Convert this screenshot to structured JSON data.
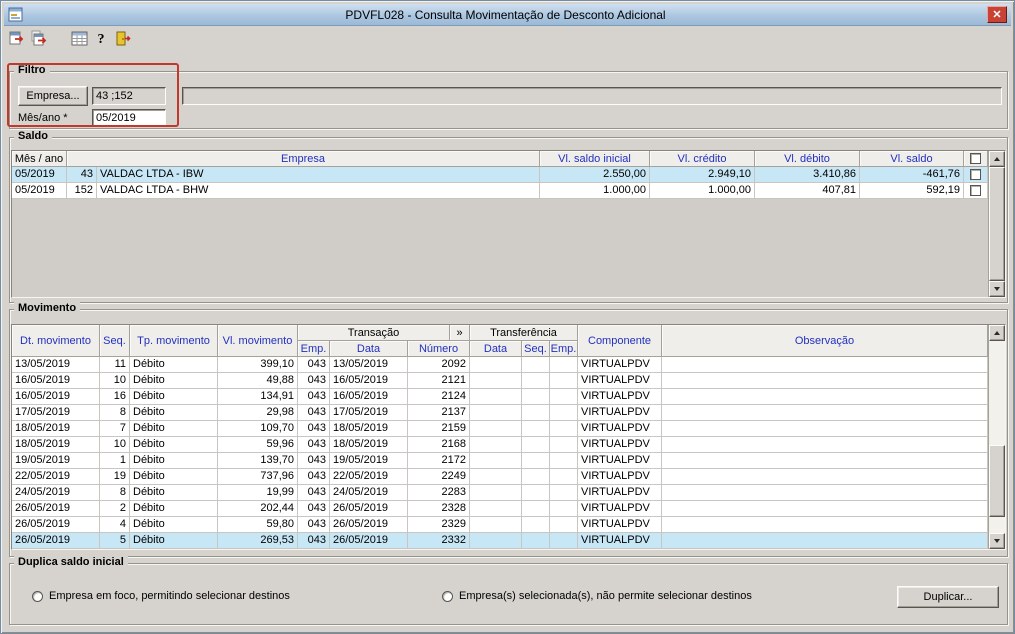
{
  "window": {
    "title": "PDVFL028 - Consulta Movimentação de Desconto Adicional",
    "close_glyph": "✕"
  },
  "toolbar": {
    "help_glyph": "?"
  },
  "filtro": {
    "legend": "Filtro",
    "empresa_button_label": "Empresa...",
    "empresa_value": "43 ;152",
    "mes_ano_label": "Mês/ano *",
    "mes_ano_value": "05/2019"
  },
  "saldo": {
    "legend": "Saldo",
    "headers": {
      "mes_ano": "Mês / ano",
      "empresa": "Empresa",
      "saldo_inicial": "Vl. saldo inicial",
      "credito": "Vl. crédito",
      "debito": "Vl. débito",
      "saldo": "Vl. saldo"
    },
    "rows": [
      {
        "mes_ano": "05/2019",
        "emp": "43",
        "empresa": "VALDAC LTDA - IBW",
        "saldo_inicial": "2.550,00",
        "credito": "2.949,10",
        "debito": "3.410,86",
        "saldo": "-461,76",
        "selected": true
      },
      {
        "mes_ano": "05/2019",
        "emp": "152",
        "empresa": "VALDAC LTDA - BHW",
        "saldo_inicial": "1.000,00",
        "credito": "1.000,00",
        "debito": "407,81",
        "saldo": "592,19",
        "selected": false
      }
    ]
  },
  "movimento": {
    "legend": "Movimento",
    "headers": {
      "dt": "Dt. movimento",
      "seq": "Seq.",
      "tp": "Tp. movimento",
      "vl": "Vl. movimento",
      "transacao": "Transação",
      "expand": "»",
      "emp": "Emp.",
      "data": "Data",
      "numero": "Número",
      "transferencia": "Transferência",
      "tr_data": "Data",
      "tr_seq": "Seq.",
      "tr_emp": "Emp.",
      "componente": "Componente",
      "observacao": "Observação"
    },
    "rows": [
      {
        "dt": "13/05/2019",
        "seq": "11",
        "tp": "Débito",
        "vl": "399,10",
        "emp": "043",
        "data": "13/05/2019",
        "numero": "2092",
        "componente": "VIRTUALPDV",
        "selected": false
      },
      {
        "dt": "16/05/2019",
        "seq": "10",
        "tp": "Débito",
        "vl": "49,88",
        "emp": "043",
        "data": "16/05/2019",
        "numero": "2121",
        "componente": "VIRTUALPDV",
        "selected": false
      },
      {
        "dt": "16/05/2019",
        "seq": "16",
        "tp": "Débito",
        "vl": "134,91",
        "emp": "043",
        "data": "16/05/2019",
        "numero": "2124",
        "componente": "VIRTUALPDV",
        "selected": false
      },
      {
        "dt": "17/05/2019",
        "seq": "8",
        "tp": "Débito",
        "vl": "29,98",
        "emp": "043",
        "data": "17/05/2019",
        "numero": "2137",
        "componente": "VIRTUALPDV",
        "selected": false
      },
      {
        "dt": "18/05/2019",
        "seq": "7",
        "tp": "Débito",
        "vl": "109,70",
        "emp": "043",
        "data": "18/05/2019",
        "numero": "2159",
        "componente": "VIRTUALPDV",
        "selected": false
      },
      {
        "dt": "18/05/2019",
        "seq": "10",
        "tp": "Débito",
        "vl": "59,96",
        "emp": "043",
        "data": "18/05/2019",
        "numero": "2168",
        "componente": "VIRTUALPDV",
        "selected": false
      },
      {
        "dt": "19/05/2019",
        "seq": "1",
        "tp": "Débito",
        "vl": "139,70",
        "emp": "043",
        "data": "19/05/2019",
        "numero": "2172",
        "componente": "VIRTUALPDV",
        "selected": false
      },
      {
        "dt": "22/05/2019",
        "seq": "19",
        "tp": "Débito",
        "vl": "737,96",
        "emp": "043",
        "data": "22/05/2019",
        "numero": "2249",
        "componente": "VIRTUALPDV",
        "selected": false
      },
      {
        "dt": "24/05/2019",
        "seq": "8",
        "tp": "Débito",
        "vl": "19,99",
        "emp": "043",
        "data": "24/05/2019",
        "numero": "2283",
        "componente": "VIRTUALPDV",
        "selected": false
      },
      {
        "dt": "26/05/2019",
        "seq": "2",
        "tp": "Débito",
        "vl": "202,44",
        "emp": "043",
        "data": "26/05/2019",
        "numero": "2328",
        "componente": "VIRTUALPDV",
        "selected": false
      },
      {
        "dt": "26/05/2019",
        "seq": "4",
        "tp": "Débito",
        "vl": "59,80",
        "emp": "043",
        "data": "26/05/2019",
        "numero": "2329",
        "componente": "VIRTUALPDV",
        "selected": false
      },
      {
        "dt": "26/05/2019",
        "seq": "5",
        "tp": "Débito",
        "vl": "269,53",
        "emp": "043",
        "data": "26/05/2019",
        "numero": "2332",
        "componente": "VIRTUALPDV",
        "selected": true
      }
    ]
  },
  "duplica": {
    "legend": "Duplica saldo inicial",
    "option_focus": "Empresa em foco, permitindo selecionar destinos",
    "option_selected": "Empresa(s) selecionada(s), não permite selecionar destinos",
    "duplicar_button_label": "Duplicar..."
  }
}
